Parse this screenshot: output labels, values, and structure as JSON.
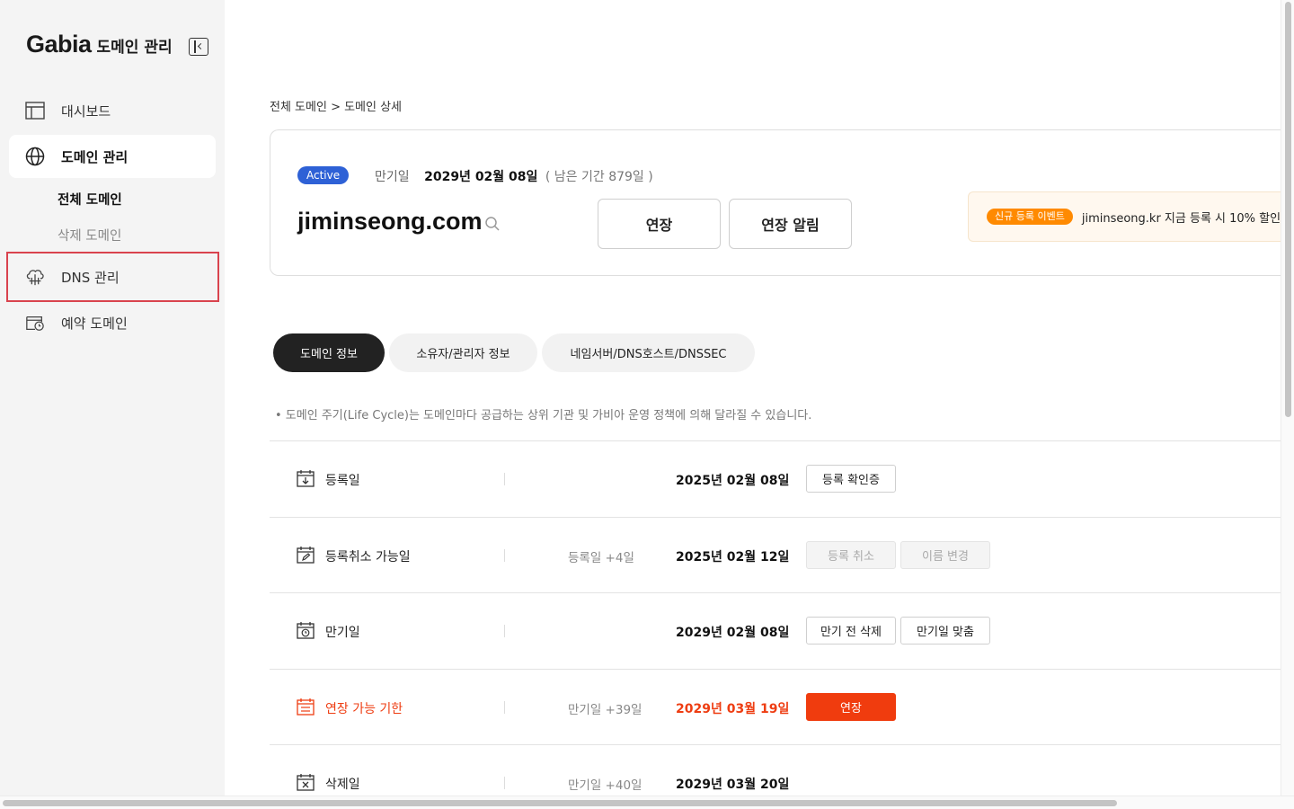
{
  "sidebar": {
    "brand": "Gabia",
    "brand_sub": "도메인 관리",
    "items": [
      {
        "label": "대시보드",
        "icon": "dashboard-icon"
      },
      {
        "label": "도메인 관리",
        "icon": "globe-icon"
      },
      {
        "label": "DNS 관리",
        "icon": "cloud-network-icon"
      },
      {
        "label": "예약 도메인",
        "icon": "calendar-clock-icon"
      }
    ],
    "sub_items": [
      "전체 도메인",
      "삭제 도메인"
    ]
  },
  "breadcrumb": "전체 도메인 > 도메인 상세",
  "summary": {
    "status": "Active",
    "expiry_label": "만기일",
    "expiry_date": "2029년 02월 08일",
    "remaining": "( 남은 기간 879일 )",
    "domain": "jiminseong.com",
    "renew_button": "연장",
    "renew_alert_button": "연장 알림",
    "promo_tag": "신규 등록 이벤트",
    "promo_text": "jiminseong.kr 지금 등록 시 10% 할인!"
  },
  "tabs": [
    "도메인 정보",
    "소유자/관리자 정보",
    "네임서버/DNS호스트/DNSSEC"
  ],
  "notice": "• 도메인 주기(Life Cycle)는 도메인마다 공급하는 상위 기관 및 가비아 운영 정책에 의해 달라질 수 있습니다.",
  "lifecycle": [
    {
      "label": "등록일",
      "offset": "",
      "date": "2025년 02월 08일",
      "buttons": [
        "등록 확인증"
      ]
    },
    {
      "label": "등록취소 가능일",
      "offset": "등록일 +4일",
      "date": "2025년 02월 12일",
      "buttons": [
        "등록 취소",
        "이름 변경"
      ]
    },
    {
      "label": "만기일",
      "offset": "",
      "date": "2029년 02월 08일",
      "buttons": [
        "만기 전 삭제",
        "만기일 맞춤"
      ]
    },
    {
      "label": "연장 가능 기한",
      "offset": "만기일 +39일",
      "date": "2029년 03월 19일",
      "buttons": [
        "연장"
      ]
    },
    {
      "label": "삭제일",
      "offset": "만기일 +40일",
      "date": "2029년 03월 20일",
      "buttons": []
    }
  ],
  "colors": {
    "accent": "#2e61d6",
    "danger": "#ee3d12",
    "highlight_border": "#d9434e",
    "promo_tag": "#ff8a00"
  }
}
